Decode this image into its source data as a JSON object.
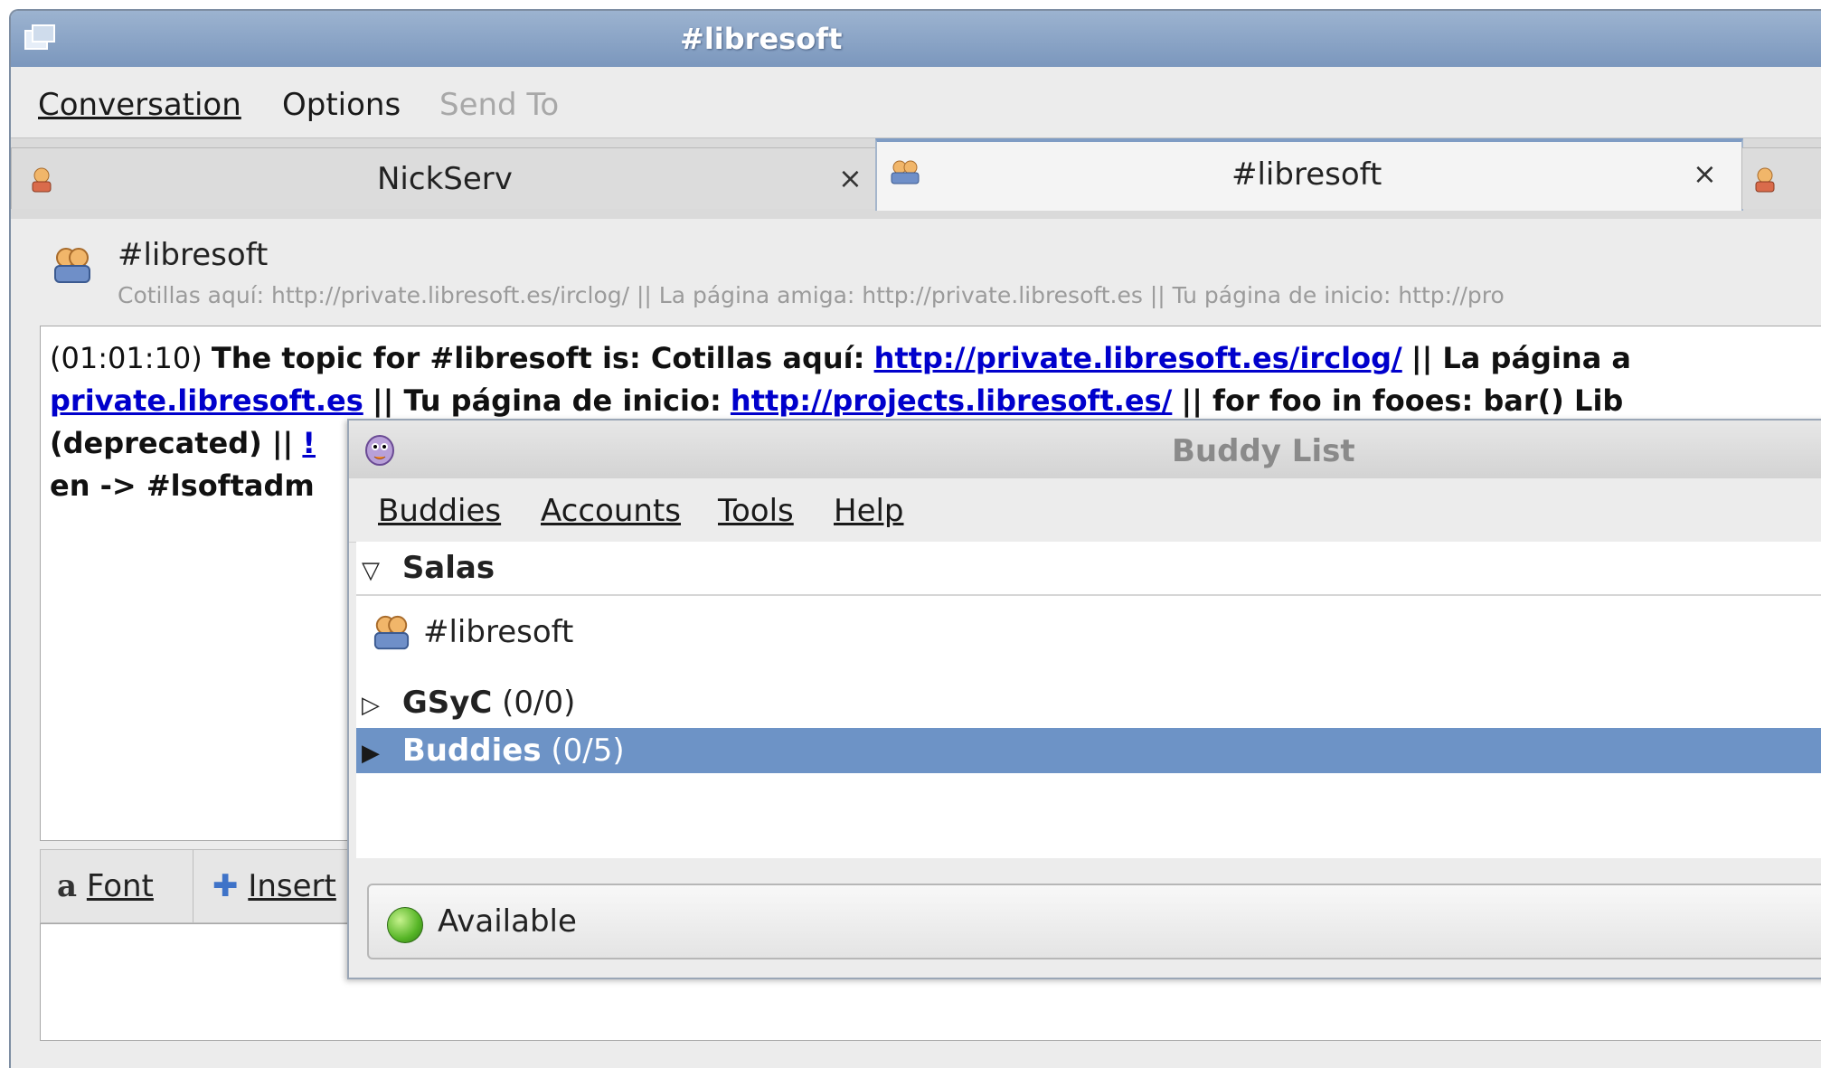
{
  "window": {
    "title": "#libresoft"
  },
  "menubar": {
    "conversation": "Conversation",
    "options": "Options",
    "send_to": "Send To"
  },
  "tabs": [
    {
      "label": "NickServ",
      "close": "×"
    },
    {
      "label": "#libresoft",
      "close": "×"
    }
  ],
  "conversation": {
    "title": "#libresoft",
    "topic": "Cotillas aquí: http://private.libresoft.es/irclog/ || La página amiga: http://private.libresoft.es || Tu página de inicio: http://pro",
    "log": {
      "timestamp": "(01:01:10)",
      "line1_text": "The topic for #libresoft is: Cotillas aquí:",
      "line1_link": "http://private.libresoft.es/irclog/",
      "line1_tail": "|| La página a",
      "line2_link1": "private.libresoft.es",
      "line2_mid": "|| Tu página de inicio:",
      "line2_link2": "http://projects.libresoft.es/",
      "line2_tail": "|| for foo in fooes: bar() Lib",
      "line3_text": "(deprecated) ||",
      "line3_link": "!",
      "line4_text": "en -> #lsoftadm"
    },
    "toolbar": {
      "font": "Font",
      "insert": "Insert"
    }
  },
  "buddy_list": {
    "title": "Buddy List",
    "menu": {
      "buddies": "Buddies",
      "accounts": "Accounts",
      "tools": "Tools",
      "help": "Help"
    },
    "groups": [
      {
        "name": "Salas",
        "expanded": true
      },
      {
        "name": "GSyC",
        "count": "(0/0)",
        "expanded": false
      },
      {
        "name": "Buddies",
        "count": "(0/5)",
        "expanded": false,
        "selected": true
      }
    ],
    "chat": "#libresoft",
    "status": "Available"
  }
}
